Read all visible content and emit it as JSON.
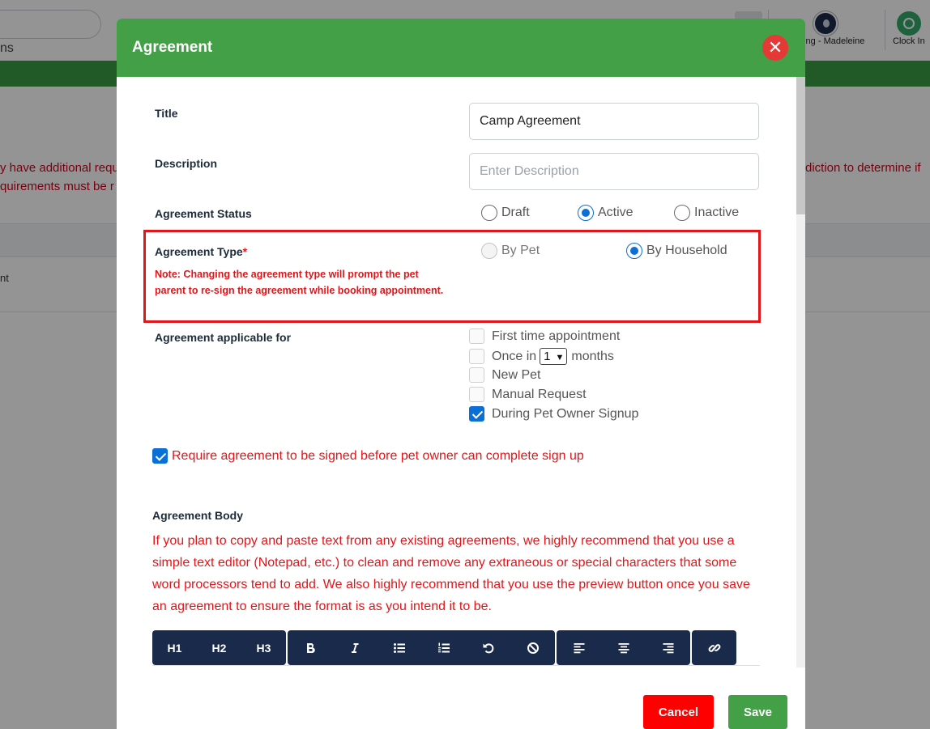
{
  "background": {
    "tab_fragment": "ns",
    "user_name": "ning - Madeleine",
    "clock_in_label": "Clock In",
    "warning_left_1": "y have additional requ",
    "warning_left_2": "quirements must be r",
    "warning_right": "diction to determine if",
    "row_fragment": "nt"
  },
  "modal": {
    "title": "Agreement",
    "fields": {
      "title_label": "Title",
      "title_value": "Camp Agreement",
      "description_label": "Description",
      "description_placeholder": "Enter Description",
      "status_label": "Agreement Status",
      "status_options": [
        {
          "label": "Draft",
          "selected": false
        },
        {
          "label": "Active",
          "selected": true
        },
        {
          "label": "Inactive",
          "selected": false
        }
      ],
      "type_label": "Agreement Type",
      "type_required_mark": "*",
      "type_note": "Note: Changing the agreement type will prompt the pet parent to re-sign the agreement while booking appointment.",
      "type_options": [
        {
          "label": "By Pet",
          "selected": false,
          "disabled": true
        },
        {
          "label": "By Household",
          "selected": true,
          "disabled": false
        }
      ],
      "applicable_label": "Agreement applicable for",
      "applicable_options": {
        "first_time": {
          "label": "First time appointment",
          "checked": false
        },
        "once_in": {
          "label_prefix": "Once in",
          "select_value": "1",
          "label_suffix": "months",
          "checked": false
        },
        "new_pet": {
          "label": "New Pet",
          "checked": false
        },
        "manual_request": {
          "label": "Manual Request",
          "checked": false
        },
        "signup": {
          "label": "During Pet Owner Signup",
          "checked": true
        }
      },
      "require_signup_label": "Require agreement to be signed before pet owner can complete sign up",
      "body_label": "Agreement Body",
      "body_note": "If you plan to copy and paste text from any existing agreements, we highly recommend that you use a simple text editor (Notepad, etc.) to clean and remove any extraneous or special characters that some word processors tend to add. We also highly recommend that you use the preview button once you save an agreement to ensure the format is as you intend it to be."
    },
    "toolbar": {
      "h1": "H1",
      "h2": "H2",
      "h3": "H3",
      "icons": [
        "bold-icon",
        "italic-icon",
        "bullet-list-icon",
        "numbered-list-icon",
        "undo-icon",
        "clear-format-icon",
        "align-left-icon",
        "align-center-icon",
        "align-right-icon",
        "link-icon"
      ]
    },
    "footer": {
      "cancel_label": "Cancel",
      "save_label": "Save"
    },
    "colors": {
      "header_green": "#43a047",
      "danger_red": "#e0161b",
      "cancel_red": "#ff0000",
      "toolbar_navy": "#1a2a4a",
      "selected_blue": "#0a6fd6"
    }
  }
}
